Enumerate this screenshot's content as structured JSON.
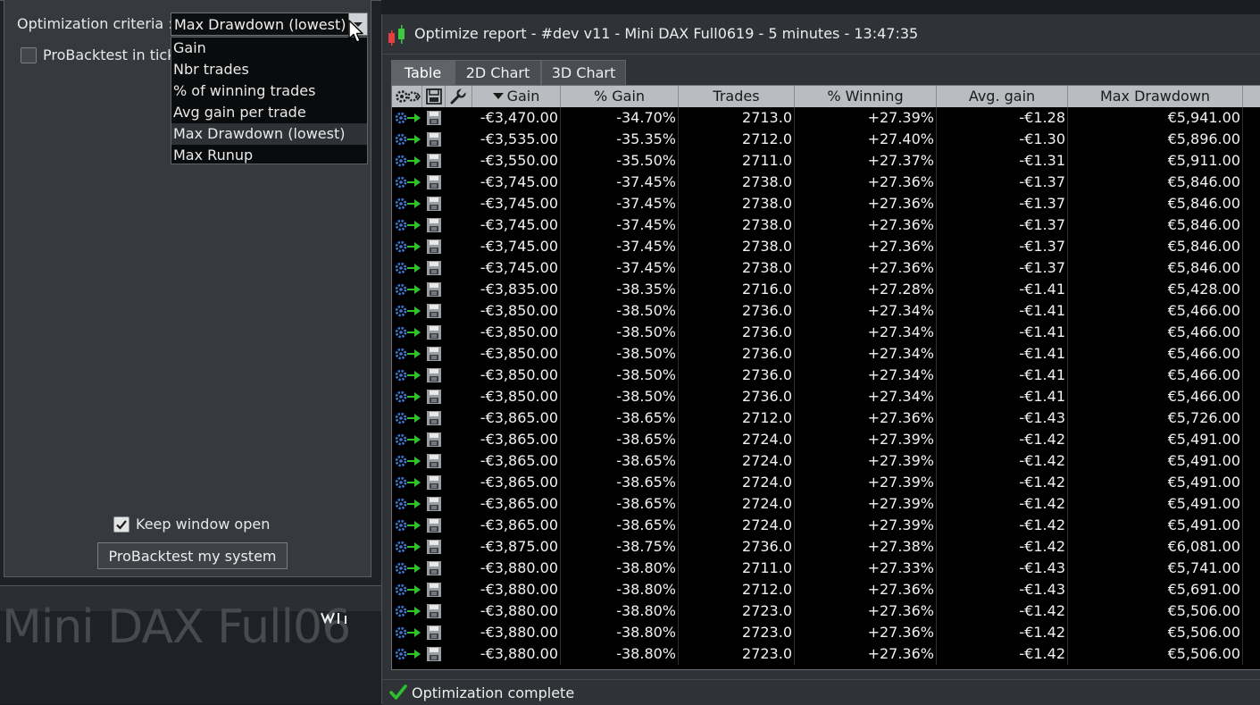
{
  "options": {
    "criteria_label": "Optimization criteria :",
    "criteria_selected": "Max Drawdown (lowest)",
    "criteria_options": [
      "Gain",
      "Nbr trades",
      "% of winning trades",
      "Avg gain per trade",
      "Max Drawdown (lowest)",
      "Max Runup"
    ],
    "probacktest_ticks_label": "ProBacktest in tick",
    "keep_open_label": "Keep window open",
    "run_button_label": "ProBacktest my system"
  },
  "background": {
    "title_fragment": "Mini DAX Full06"
  },
  "report": {
    "title": "Optimize report - #dev v11 - Mini DAX Full0619 - 5 minutes - 13:47:35",
    "tabs": [
      "Table",
      "2D Chart",
      "3D Chart"
    ],
    "active_tab": "Table",
    "columns": [
      "Gain",
      "% Gain",
      "Trades",
      "% Winning",
      "Avg. gain",
      "Max Drawdown"
    ],
    "rows": [
      [
        "-€3,470.00",
        "-34.70%",
        "2713.0",
        "+27.39%",
        "-€1.28",
        "€5,941.00"
      ],
      [
        "-€3,535.00",
        "-35.35%",
        "2712.0",
        "+27.40%",
        "-€1.30",
        "€5,896.00"
      ],
      [
        "-€3,550.00",
        "-35.50%",
        "2711.0",
        "+27.37%",
        "-€1.31",
        "€5,911.00"
      ],
      [
        "-€3,745.00",
        "-37.45%",
        "2738.0",
        "+27.36%",
        "-€1.37",
        "€5,846.00"
      ],
      [
        "-€3,745.00",
        "-37.45%",
        "2738.0",
        "+27.36%",
        "-€1.37",
        "€5,846.00"
      ],
      [
        "-€3,745.00",
        "-37.45%",
        "2738.0",
        "+27.36%",
        "-€1.37",
        "€5,846.00"
      ],
      [
        "-€3,745.00",
        "-37.45%",
        "2738.0",
        "+27.36%",
        "-€1.37",
        "€5,846.00"
      ],
      [
        "-€3,745.00",
        "-37.45%",
        "2738.0",
        "+27.36%",
        "-€1.37",
        "€5,846.00"
      ],
      [
        "-€3,835.00",
        "-38.35%",
        "2716.0",
        "+27.28%",
        "-€1.41",
        "€5,428.00"
      ],
      [
        "-€3,850.00",
        "-38.50%",
        "2736.0",
        "+27.34%",
        "-€1.41",
        "€5,466.00"
      ],
      [
        "-€3,850.00",
        "-38.50%",
        "2736.0",
        "+27.34%",
        "-€1.41",
        "€5,466.00"
      ],
      [
        "-€3,850.00",
        "-38.50%",
        "2736.0",
        "+27.34%",
        "-€1.41",
        "€5,466.00"
      ],
      [
        "-€3,850.00",
        "-38.50%",
        "2736.0",
        "+27.34%",
        "-€1.41",
        "€5,466.00"
      ],
      [
        "-€3,850.00",
        "-38.50%",
        "2736.0",
        "+27.34%",
        "-€1.41",
        "€5,466.00"
      ],
      [
        "-€3,865.00",
        "-38.65%",
        "2712.0",
        "+27.36%",
        "-€1.43",
        "€5,726.00"
      ],
      [
        "-€3,865.00",
        "-38.65%",
        "2724.0",
        "+27.39%",
        "-€1.42",
        "€5,491.00"
      ],
      [
        "-€3,865.00",
        "-38.65%",
        "2724.0",
        "+27.39%",
        "-€1.42",
        "€5,491.00"
      ],
      [
        "-€3,865.00",
        "-38.65%",
        "2724.0",
        "+27.39%",
        "-€1.42",
        "€5,491.00"
      ],
      [
        "-€3,865.00",
        "-38.65%",
        "2724.0",
        "+27.39%",
        "-€1.42",
        "€5,491.00"
      ],
      [
        "-€3,865.00",
        "-38.65%",
        "2724.0",
        "+27.39%",
        "-€1.42",
        "€5,491.00"
      ],
      [
        "-€3,875.00",
        "-38.75%",
        "2736.0",
        "+27.38%",
        "-€1.42",
        "€6,081.00"
      ],
      [
        "-€3,880.00",
        "-38.80%",
        "2711.0",
        "+27.33%",
        "-€1.43",
        "€5,741.00"
      ],
      [
        "-€3,880.00",
        "-38.80%",
        "2712.0",
        "+27.36%",
        "-€1.43",
        "€5,691.00"
      ],
      [
        "-€3,880.00",
        "-38.80%",
        "2723.0",
        "+27.36%",
        "-€1.42",
        "€5,506.00"
      ],
      [
        "-€3,880.00",
        "-38.80%",
        "2723.0",
        "+27.36%",
        "-€1.42",
        "€5,506.00"
      ],
      [
        "-€3,880.00",
        "-38.80%",
        "2723.0",
        "+27.36%",
        "-€1.42",
        "€5,506.00"
      ]
    ],
    "status": "Optimization complete"
  },
  "icons": {
    "app": "candlestick-chart-icon",
    "row_actions": [
      "gear-arrow-icon",
      "save-icon"
    ],
    "header_actions": [
      "gears-icon",
      "save-icon",
      "wrench-icon"
    ],
    "status": "green-check-icon",
    "cursor": "mouse-pointer-icon"
  },
  "colors": {
    "accent_green": "#2fbf2f",
    "table_bg": "#000000",
    "header_bg": "#b9bcc0"
  }
}
